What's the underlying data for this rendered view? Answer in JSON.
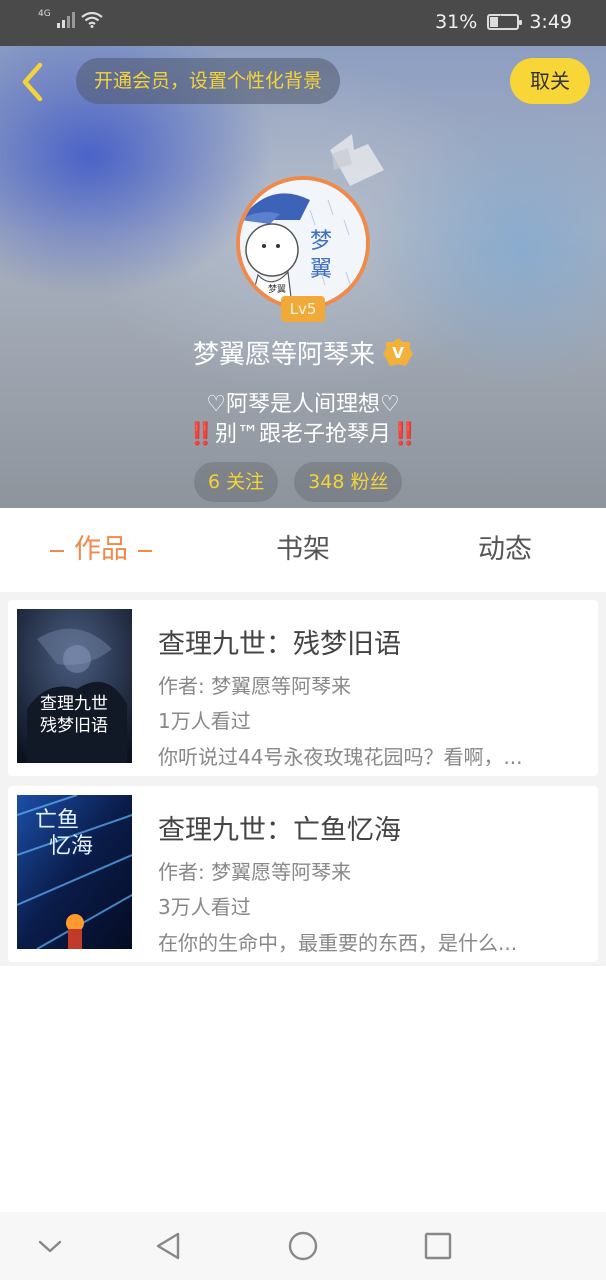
{
  "status_bar": {
    "network": "4G",
    "battery": "31%",
    "battery_level": 0.31,
    "time": "3:49"
  },
  "header": {
    "vip_prompt": "开通会员，设置个性化背景",
    "unfollow_label": "取关",
    "avatar_text": "梦翼",
    "level": "Lv5",
    "username": "梦翼愿等阿琴来",
    "verified_mark": "V",
    "bio_line1": "♡阿琴是人间理想♡",
    "bio_line2": "‼️别™跟老子抢琴月‼️",
    "following": "6 关注",
    "followers": "348 粉丝",
    "accent_color": "#f5d33a"
  },
  "tabs": {
    "works": "作品",
    "bookshelf": "书架",
    "activity": "动态",
    "active_color": "#f08a4b"
  },
  "works": [
    {
      "title": "查理九世：残梦旧语",
      "author": "作者: 梦翼愿等阿琴来",
      "views": "1万人看过",
      "desc": "你听说过44号永夜玫瑰花园吗？看啊，..."
    },
    {
      "title": "查理九世：亡鱼忆海",
      "author": "作者: 梦翼愿等阿琴来",
      "views": "3万人看过",
      "desc": "在你的生命中，最重要的东西，是什么..."
    }
  ]
}
